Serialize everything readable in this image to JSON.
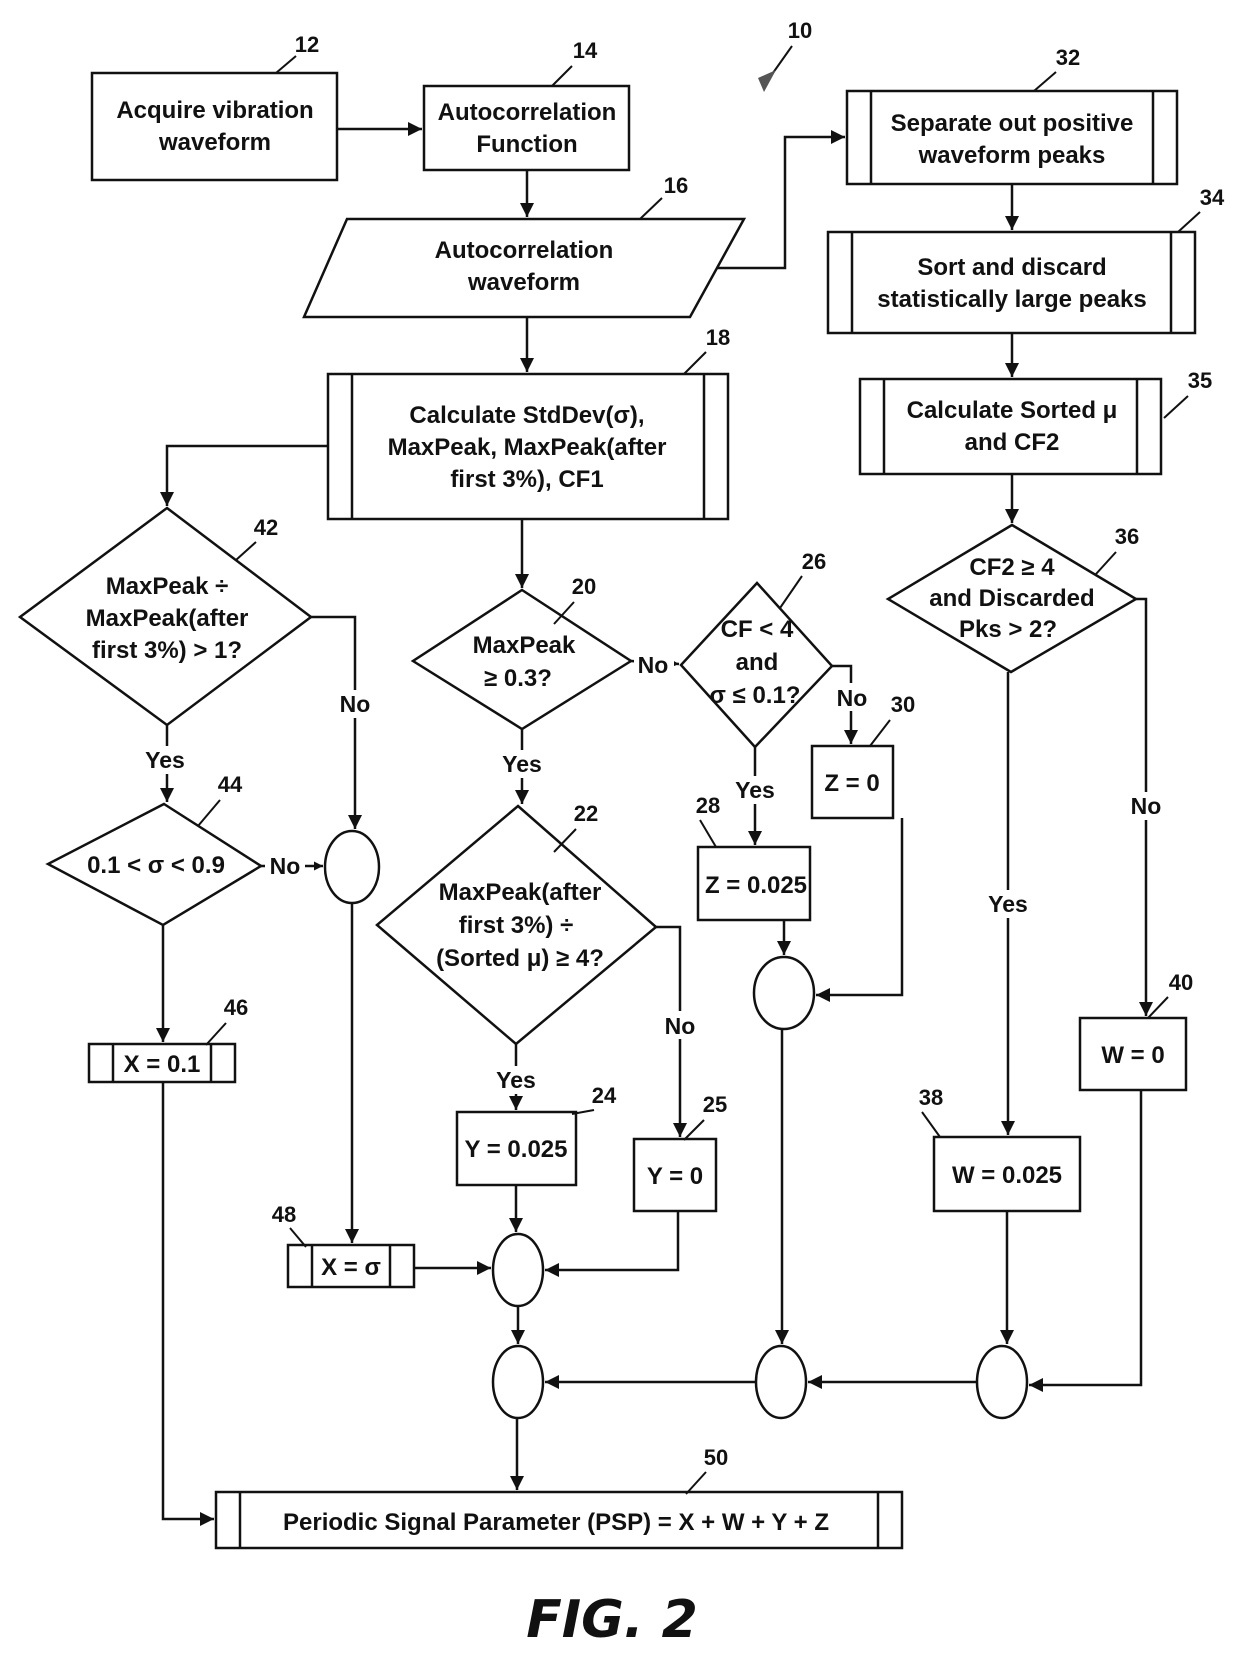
{
  "figure": {
    "caption": "FIG. 2",
    "reference": "10"
  },
  "nodes": {
    "n12": {
      "ref": "12",
      "lines": [
        "Acquire vibration",
        "waveform"
      ]
    },
    "n14": {
      "ref": "14",
      "lines": [
        "Autocorrelation",
        "Function"
      ]
    },
    "n16": {
      "ref": "16",
      "lines": [
        "Autocorrelation",
        "waveform"
      ]
    },
    "n18": {
      "ref": "18",
      "lines": [
        "Calculate StdDev(σ),",
        "MaxPeak, MaxPeak(after",
        "first 3%), CF1"
      ]
    },
    "n20": {
      "ref": "20",
      "lines": [
        "MaxPeak",
        "≥ 0.3?"
      ]
    },
    "n22": {
      "ref": "22",
      "lines": [
        "MaxPeak(after",
        "first 3%) ÷",
        "(Sorted μ) ≥ 4?"
      ]
    },
    "n24": {
      "ref": "24",
      "lines": [
        "Y = 0.025"
      ]
    },
    "n25": {
      "ref": "25",
      "lines": [
        "Y = 0"
      ]
    },
    "n26": {
      "ref": "26",
      "lines": [
        "CF < 4",
        "and",
        "σ ≤ 0.1?"
      ]
    },
    "n28": {
      "ref": "28",
      "lines": [
        "Z = 0.025"
      ]
    },
    "n30": {
      "ref": "30",
      "lines": [
        "Z = 0"
      ]
    },
    "n32": {
      "ref": "32",
      "lines": [
        "Separate out positive",
        "waveform peaks"
      ]
    },
    "n34": {
      "ref": "34",
      "lines": [
        "Sort and discard",
        "statistically large peaks"
      ]
    },
    "n35": {
      "ref": "35",
      "lines": [
        "Calculate Sorted μ",
        "and CF2"
      ]
    },
    "n36": {
      "ref": "36",
      "lines": [
        "CF2 ≥ 4",
        "and Discarded",
        "Pks > 2?"
      ]
    },
    "n38": {
      "ref": "38",
      "lines": [
        "W = 0.025"
      ]
    },
    "n40": {
      "ref": "40",
      "lines": [
        "W = 0"
      ]
    },
    "n42": {
      "ref": "42",
      "lines": [
        "MaxPeak ÷",
        "MaxPeak(after",
        "first 3%) > 1?"
      ]
    },
    "n44": {
      "ref": "44",
      "lines": [
        "0.1 < σ < 0.9"
      ]
    },
    "n46": {
      "ref": "46",
      "lines": [
        "X = 0.1"
      ]
    },
    "n48": {
      "ref": "48",
      "lines": [
        "X = σ"
      ]
    },
    "n50": {
      "ref": "50",
      "lines": [
        "Periodic Signal Parameter (PSP) = X + W + Y + Z"
      ]
    }
  },
  "branch_labels": {
    "yes": "Yes",
    "no": "No"
  }
}
